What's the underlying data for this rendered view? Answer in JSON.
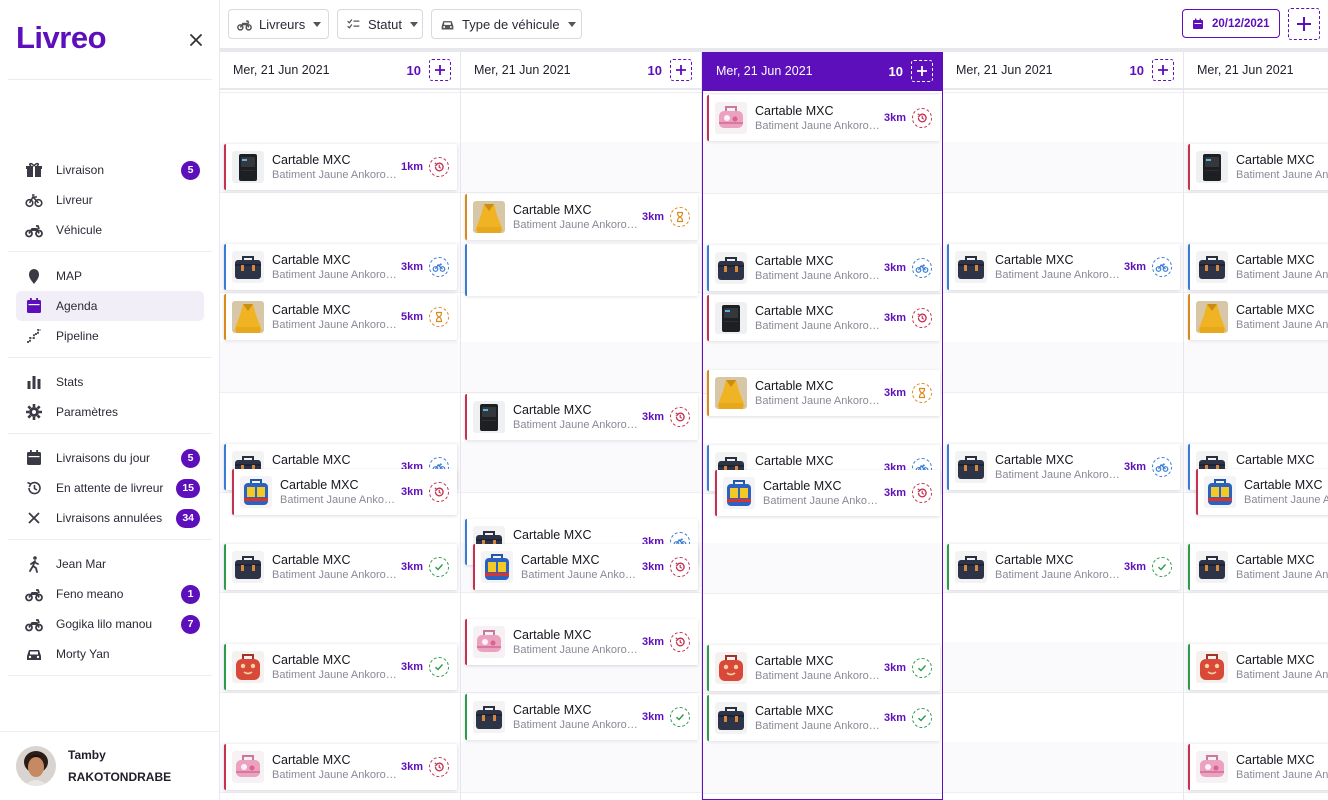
{
  "app": {
    "logo": "Livreo"
  },
  "colors": {
    "accent": "#5c0fbb",
    "status_retour": "#c4324f",
    "status_attente": "#d98a1f",
    "status_livreur": "#3a7bd5",
    "status_livre": "#2e9b4b"
  },
  "sidebar": {
    "groups": [
      [
        {
          "label": "Livraison",
          "icon": "gift-icon",
          "badge": "5"
        },
        {
          "label": "Livreur",
          "icon": "bicycle-icon",
          "badge": ""
        },
        {
          "label": "Véhicule",
          "icon": "motorbike-icon",
          "badge": ""
        }
      ],
      [
        {
          "label": "MAP",
          "icon": "map-pin-icon",
          "badge": ""
        },
        {
          "label": "Agenda",
          "icon": "calendar-icon",
          "badge": "",
          "active": true
        },
        {
          "label": "Pipeline",
          "icon": "pipeline-icon",
          "badge": ""
        }
      ],
      [
        {
          "label": "Stats",
          "icon": "bar-chart-icon",
          "badge": ""
        },
        {
          "label": "Paramètres",
          "icon": "gear-icon",
          "badge": ""
        }
      ],
      [
        {
          "label": "Livraisons du jour",
          "icon": "calendar-icon",
          "badge": "5"
        },
        {
          "label": "En attente de livreur",
          "icon": "history-icon",
          "badge": "15"
        },
        {
          "label": "Livraisons annulées",
          "icon": "close-icon",
          "badge": "34"
        }
      ],
      [
        {
          "label": "Jean Mar",
          "icon": "walker-icon",
          "badge": ""
        },
        {
          "label": "Feno meano",
          "icon": "motorbike-icon",
          "badge": "1"
        },
        {
          "label": "Gogika lilo manou",
          "icon": "motorbike-icon",
          "badge": "7"
        },
        {
          "label": "Morty Yan",
          "icon": "car-icon",
          "badge": ""
        }
      ]
    ],
    "profile": {
      "first_name": "Tamby",
      "last_name": "RAKOTONDRABE"
    }
  },
  "toolbar": {
    "filters": [
      {
        "label": "Livreurs",
        "icon": "motorbike-icon"
      },
      {
        "label": "Statut",
        "icon": "check-list-icon"
      },
      {
        "label": "Type de véhicule",
        "icon": "car-icon"
      }
    ],
    "date": "20/12/2021"
  },
  "card_defaults": {
    "title": "Cartable MXC",
    "subtitle": "Batiment Jaune Ankorondrano"
  },
  "columns": [
    {
      "date": "Mer, 21 Jun 2021",
      "count": "10",
      "active": false,
      "cards": [
        {
          "slot": 1,
          "thumb": "black-bag",
          "km": "1km",
          "status": "retour"
        },
        {
          "slot": 3,
          "thumb": "navy-bag",
          "km": "3km",
          "status": "livreur"
        },
        {
          "slot": 4,
          "thumb": "yellow-dress",
          "km": "5km",
          "status": "attente"
        },
        {
          "slot": 7,
          "thumb": "navy-bag",
          "km": "3km",
          "status": "livreur"
        },
        {
          "slot": 7.5,
          "thumb": "blue-yellow-bag",
          "km": "3km",
          "status": "retour",
          "indent": true
        },
        {
          "slot": 9,
          "thumb": "navy-bag",
          "km": "3km",
          "status": "livre"
        },
        {
          "slot": 11,
          "thumb": "red-bag",
          "km": "3km",
          "status": "livre"
        },
        {
          "slot": 13,
          "thumb": "pink-bag",
          "km": "3km",
          "status": "retour"
        }
      ]
    },
    {
      "date": "Mer, 21 Jun 2021",
      "count": "10",
      "active": false,
      "cards": [
        {
          "slot": 2,
          "thumb": "yellow-dress",
          "km": "3km",
          "status": "attente"
        },
        {
          "slot": 3,
          "empty": true,
          "status": "livreur"
        },
        {
          "slot": 6,
          "thumb": "black-bag",
          "km": "3km",
          "status": "retour"
        },
        {
          "slot": 8.5,
          "thumb": "navy-bag",
          "km": "3km",
          "status": "livreur"
        },
        {
          "slot": 9,
          "thumb": "blue-yellow-bag",
          "km": "3km",
          "status": "retour",
          "indent": true
        },
        {
          "slot": 10.5,
          "thumb": "pink-bag",
          "km": "3km",
          "status": "retour"
        },
        {
          "slot": 12,
          "thumb": "navy-bag",
          "km": "3km",
          "status": "livre"
        }
      ]
    },
    {
      "date": "Mer, 21 Jun 2021",
      "count": "10",
      "active": true,
      "cards": [
        {
          "slot": 0,
          "thumb": "pink-bag",
          "km": "3km",
          "status": "retour"
        },
        {
          "slot": 3,
          "thumb": "navy-bag",
          "km": "3km",
          "status": "livreur"
        },
        {
          "slot": 4,
          "thumb": "black-bag",
          "km": "3km",
          "status": "retour"
        },
        {
          "slot": 5.5,
          "thumb": "yellow-dress",
          "km": "3km",
          "status": "attente"
        },
        {
          "slot": 7,
          "thumb": "navy-bag",
          "km": "3km",
          "status": "livreur"
        },
        {
          "slot": 7.5,
          "thumb": "blue-yellow-bag",
          "km": "3km",
          "status": "retour",
          "indent": true
        },
        {
          "slot": 11,
          "thumb": "red-bag",
          "km": "3km",
          "status": "livre"
        },
        {
          "slot": 12,
          "thumb": "navy-bag",
          "km": "3km",
          "status": "livre"
        }
      ]
    },
    {
      "date": "Mer, 21 Jun 2021",
      "count": "10",
      "active": false,
      "cards": [
        {
          "slot": 3,
          "thumb": "navy-bag",
          "km": "3km",
          "status": "livreur"
        },
        {
          "slot": 7,
          "thumb": "navy-bag",
          "km": "3km",
          "status": "livreur"
        },
        {
          "slot": 9,
          "thumb": "navy-bag",
          "km": "3km",
          "status": "livre"
        }
      ]
    },
    {
      "date": "Mer, 21 Jun 2021",
      "count": "",
      "active": false,
      "cards": [
        {
          "slot": 1,
          "thumb": "black-bag",
          "km": "",
          "status": "retour"
        },
        {
          "slot": 3,
          "thumb": "navy-bag",
          "km": "",
          "status": "livreur"
        },
        {
          "slot": 4,
          "thumb": "yellow-dress",
          "km": "",
          "status": "attente"
        },
        {
          "slot": 7,
          "thumb": "navy-bag",
          "km": "",
          "status": "livreur"
        },
        {
          "slot": 7.5,
          "thumb": "blue-yellow-bag",
          "km": "",
          "status": "retour",
          "indent": true
        },
        {
          "slot": 9,
          "thumb": "navy-bag",
          "km": "",
          "status": "livre"
        },
        {
          "slot": 11,
          "thumb": "red-bag",
          "km": "",
          "status": "livre"
        },
        {
          "slot": 13,
          "thumb": "pink-bag",
          "km": "",
          "status": "retour"
        }
      ]
    }
  ]
}
